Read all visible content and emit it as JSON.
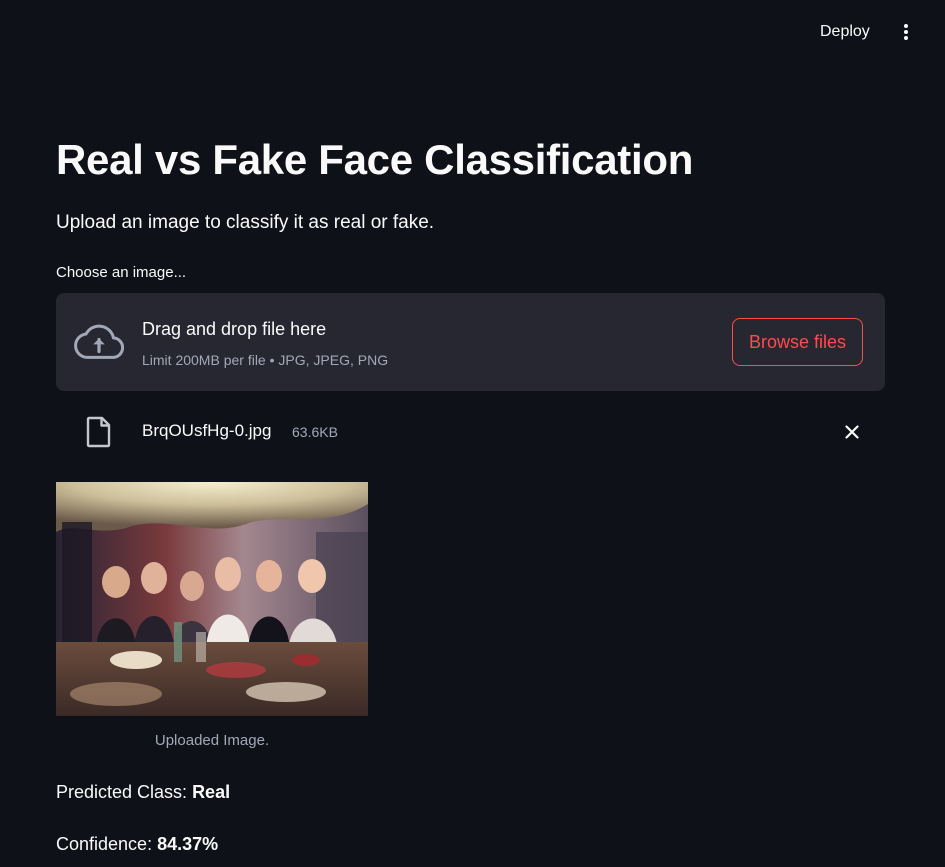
{
  "header": {
    "deploy_label": "Deploy",
    "menu_icon": "vertical-ellipsis-icon"
  },
  "main": {
    "title": "Real vs Fake Face Classification",
    "subtitle": "Upload an image to classify it as real or fake.",
    "uploader": {
      "label": "Choose an image...",
      "instructions": "Drag and drop file here",
      "limit": "Limit 200MB per file • JPG, JPEG, PNG",
      "browse_label": "Browse files",
      "upload_icon": "cloud-upload-icon"
    },
    "file": {
      "name": "BrqOUsfHg-0.jpg",
      "size": "63.6KB",
      "file_icon": "file-icon",
      "remove_icon": "close-icon"
    },
    "image": {
      "caption": "Uploaded Image."
    },
    "result": {
      "predicted_label": "Predicted Class: ",
      "predicted_value": "Real",
      "confidence_label": "Confidence: ",
      "confidence_value": "84.37%"
    }
  },
  "colors": {
    "background": "#0e1117",
    "panel": "#262730",
    "accent": "#ff4b4b",
    "text": "#fafafa",
    "muted": "#a3a8b8"
  }
}
